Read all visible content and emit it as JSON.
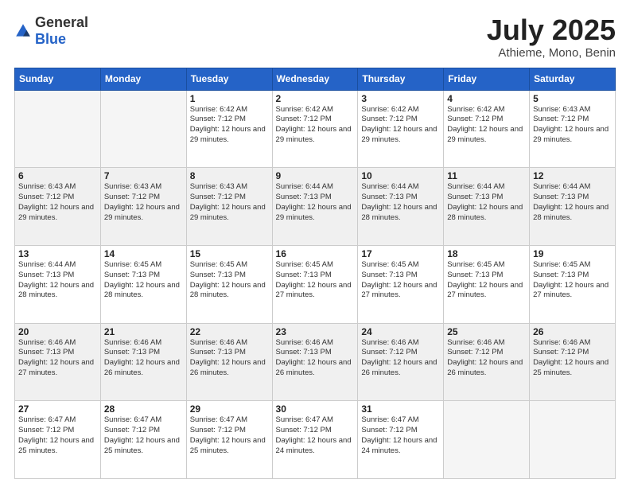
{
  "logo": {
    "general": "General",
    "blue": "Blue"
  },
  "title": {
    "month_year": "July 2025",
    "location": "Athieme, Mono, Benin"
  },
  "weekdays": [
    "Sunday",
    "Monday",
    "Tuesday",
    "Wednesday",
    "Thursday",
    "Friday",
    "Saturday"
  ],
  "weeks": [
    [
      {
        "day": "",
        "info": ""
      },
      {
        "day": "",
        "info": ""
      },
      {
        "day": "1",
        "info": "Sunrise: 6:42 AM\nSunset: 7:12 PM\nDaylight: 12 hours and 29 minutes."
      },
      {
        "day": "2",
        "info": "Sunrise: 6:42 AM\nSunset: 7:12 PM\nDaylight: 12 hours and 29 minutes."
      },
      {
        "day": "3",
        "info": "Sunrise: 6:42 AM\nSunset: 7:12 PM\nDaylight: 12 hours and 29 minutes."
      },
      {
        "day": "4",
        "info": "Sunrise: 6:42 AM\nSunset: 7:12 PM\nDaylight: 12 hours and 29 minutes."
      },
      {
        "day": "5",
        "info": "Sunrise: 6:43 AM\nSunset: 7:12 PM\nDaylight: 12 hours and 29 minutes."
      }
    ],
    [
      {
        "day": "6",
        "info": "Sunrise: 6:43 AM\nSunset: 7:12 PM\nDaylight: 12 hours and 29 minutes."
      },
      {
        "day": "7",
        "info": "Sunrise: 6:43 AM\nSunset: 7:12 PM\nDaylight: 12 hours and 29 minutes."
      },
      {
        "day": "8",
        "info": "Sunrise: 6:43 AM\nSunset: 7:12 PM\nDaylight: 12 hours and 29 minutes."
      },
      {
        "day": "9",
        "info": "Sunrise: 6:44 AM\nSunset: 7:13 PM\nDaylight: 12 hours and 29 minutes."
      },
      {
        "day": "10",
        "info": "Sunrise: 6:44 AM\nSunset: 7:13 PM\nDaylight: 12 hours and 28 minutes."
      },
      {
        "day": "11",
        "info": "Sunrise: 6:44 AM\nSunset: 7:13 PM\nDaylight: 12 hours and 28 minutes."
      },
      {
        "day": "12",
        "info": "Sunrise: 6:44 AM\nSunset: 7:13 PM\nDaylight: 12 hours and 28 minutes."
      }
    ],
    [
      {
        "day": "13",
        "info": "Sunrise: 6:44 AM\nSunset: 7:13 PM\nDaylight: 12 hours and 28 minutes."
      },
      {
        "day": "14",
        "info": "Sunrise: 6:45 AM\nSunset: 7:13 PM\nDaylight: 12 hours and 28 minutes."
      },
      {
        "day": "15",
        "info": "Sunrise: 6:45 AM\nSunset: 7:13 PM\nDaylight: 12 hours and 28 minutes."
      },
      {
        "day": "16",
        "info": "Sunrise: 6:45 AM\nSunset: 7:13 PM\nDaylight: 12 hours and 27 minutes."
      },
      {
        "day": "17",
        "info": "Sunrise: 6:45 AM\nSunset: 7:13 PM\nDaylight: 12 hours and 27 minutes."
      },
      {
        "day": "18",
        "info": "Sunrise: 6:45 AM\nSunset: 7:13 PM\nDaylight: 12 hours and 27 minutes."
      },
      {
        "day": "19",
        "info": "Sunrise: 6:45 AM\nSunset: 7:13 PM\nDaylight: 12 hours and 27 minutes."
      }
    ],
    [
      {
        "day": "20",
        "info": "Sunrise: 6:46 AM\nSunset: 7:13 PM\nDaylight: 12 hours and 27 minutes."
      },
      {
        "day": "21",
        "info": "Sunrise: 6:46 AM\nSunset: 7:13 PM\nDaylight: 12 hours and 26 minutes."
      },
      {
        "day": "22",
        "info": "Sunrise: 6:46 AM\nSunset: 7:13 PM\nDaylight: 12 hours and 26 minutes."
      },
      {
        "day": "23",
        "info": "Sunrise: 6:46 AM\nSunset: 7:13 PM\nDaylight: 12 hours and 26 minutes."
      },
      {
        "day": "24",
        "info": "Sunrise: 6:46 AM\nSunset: 7:12 PM\nDaylight: 12 hours and 26 minutes."
      },
      {
        "day": "25",
        "info": "Sunrise: 6:46 AM\nSunset: 7:12 PM\nDaylight: 12 hours and 26 minutes."
      },
      {
        "day": "26",
        "info": "Sunrise: 6:46 AM\nSunset: 7:12 PM\nDaylight: 12 hours and 25 minutes."
      }
    ],
    [
      {
        "day": "27",
        "info": "Sunrise: 6:47 AM\nSunset: 7:12 PM\nDaylight: 12 hours and 25 minutes."
      },
      {
        "day": "28",
        "info": "Sunrise: 6:47 AM\nSunset: 7:12 PM\nDaylight: 12 hours and 25 minutes."
      },
      {
        "day": "29",
        "info": "Sunrise: 6:47 AM\nSunset: 7:12 PM\nDaylight: 12 hours and 25 minutes."
      },
      {
        "day": "30",
        "info": "Sunrise: 6:47 AM\nSunset: 7:12 PM\nDaylight: 12 hours and 24 minutes."
      },
      {
        "day": "31",
        "info": "Sunrise: 6:47 AM\nSunset: 7:12 PM\nDaylight: 12 hours and 24 minutes."
      },
      {
        "day": "",
        "info": ""
      },
      {
        "day": "",
        "info": ""
      }
    ]
  ]
}
